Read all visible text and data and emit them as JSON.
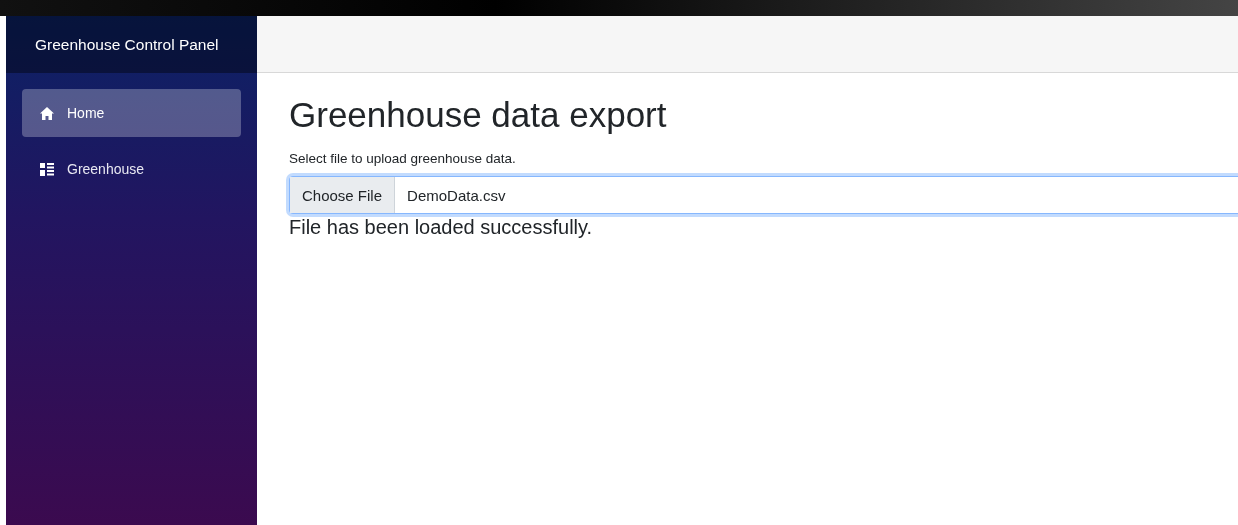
{
  "sidebar": {
    "title": "Greenhouse Control Panel",
    "items": [
      {
        "label": "Home",
        "kind": "home",
        "selected": true
      },
      {
        "label": "Greenhouse",
        "kind": "list",
        "selected": false
      }
    ]
  },
  "main": {
    "heading": "Greenhouse data export",
    "instruction": "Select file to upload greenhouse data.",
    "file_input": {
      "button": "Choose File",
      "value": "DemoData.csv",
      "focused": true
    },
    "status": "File has been loaded successfully."
  }
}
